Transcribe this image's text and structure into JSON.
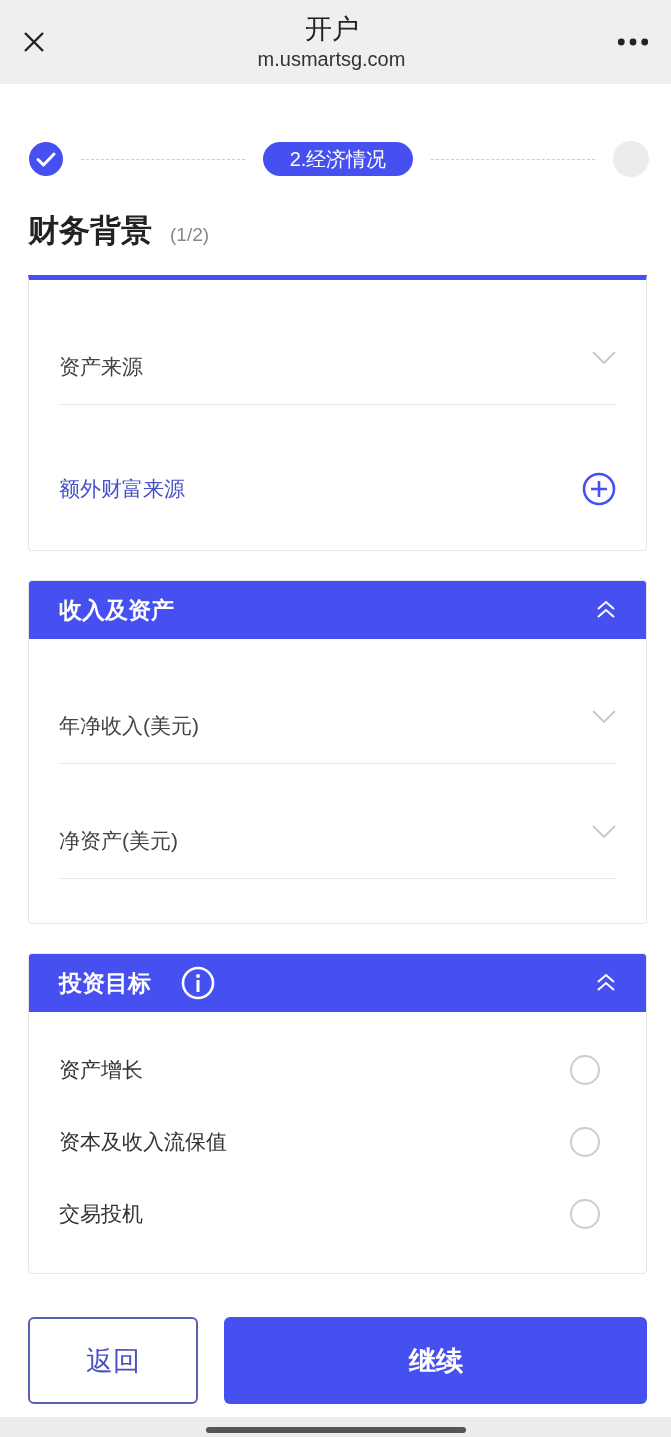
{
  "header": {
    "title": "开户",
    "url": "m.usmartsg.com"
  },
  "steps": [
    {
      "kind": "done"
    },
    {
      "kind": "current",
      "label": "2.经济情况"
    },
    {
      "kind": "pending"
    }
  ],
  "page_title": "财务背景",
  "page_count": "(1/2)",
  "sections": [
    {
      "fields": [
        {
          "kind": "select",
          "label": "资产来源"
        },
        {
          "kind": "add",
          "label": "额外财富来源"
        }
      ]
    },
    {
      "title": "收入及资产",
      "expanded": true,
      "fields": [
        {
          "kind": "select",
          "label": "年净收入(美元)"
        },
        {
          "kind": "select",
          "label": "净资产(美元)"
        }
      ]
    },
    {
      "title": "投资目标",
      "info": true,
      "expanded": true,
      "fields": [
        {
          "kind": "radio",
          "label": "资产增长",
          "selected": false
        },
        {
          "kind": "radio",
          "label": "资本及收入流保值",
          "selected": false
        },
        {
          "kind": "radio",
          "label": "交易投机",
          "selected": false
        }
      ]
    }
  ],
  "buttons": [
    {
      "kind": "secondary",
      "label": "返回"
    },
    {
      "kind": "primary",
      "label": "继续"
    }
  ]
}
